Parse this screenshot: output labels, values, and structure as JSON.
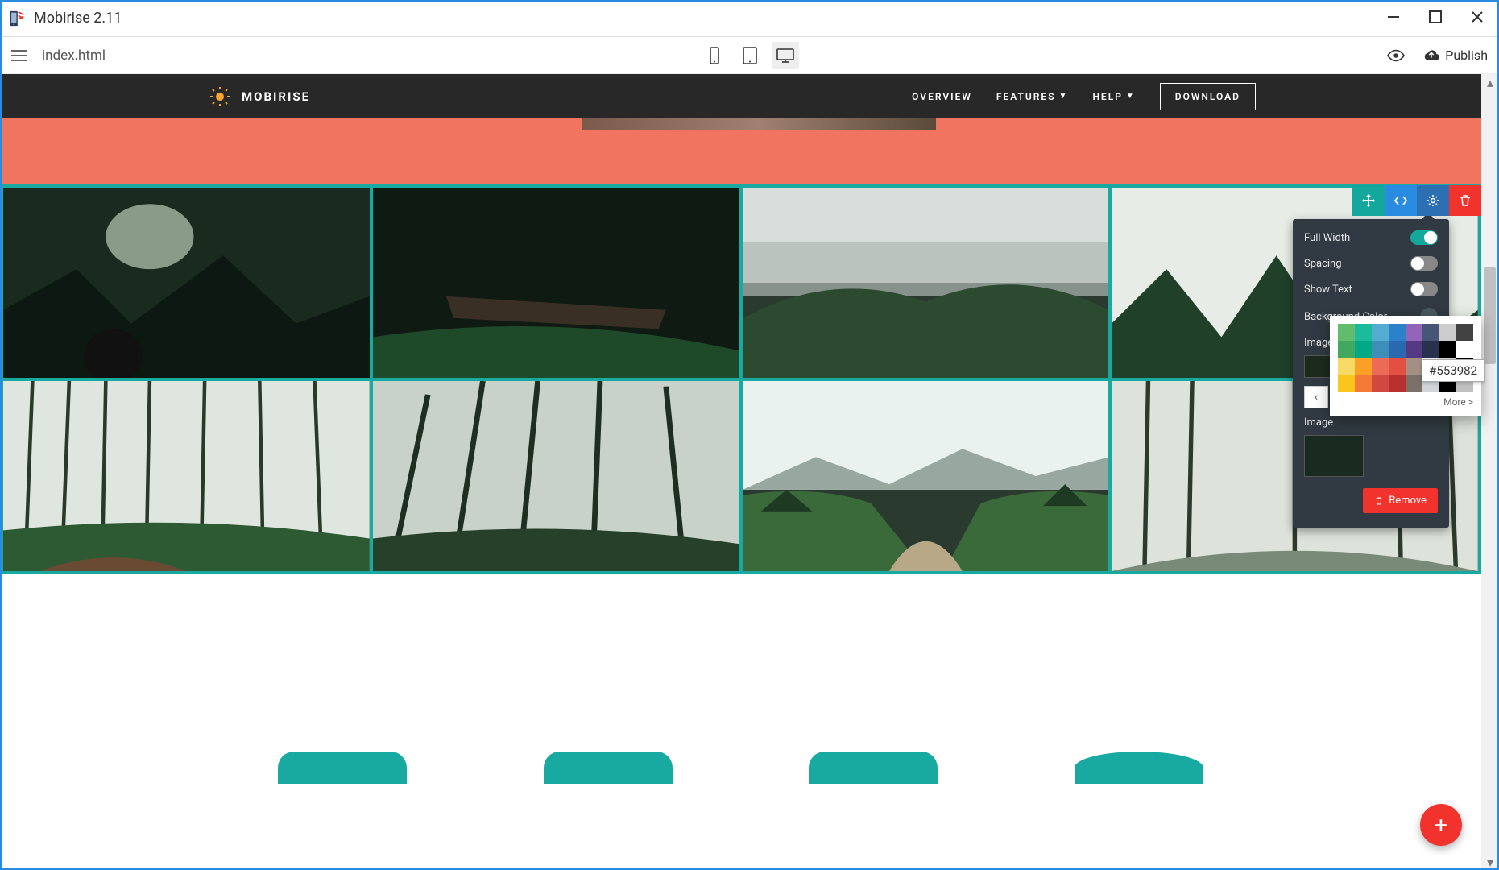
{
  "app": {
    "title": "Mobirise 2.11"
  },
  "toolbar": {
    "filename": "index.html",
    "publish_label": "Publish"
  },
  "site": {
    "brand": "MOBIRISE",
    "nav": {
      "overview": "OVERVIEW",
      "features": "FEATURES",
      "help": "HELP",
      "download": "DOWNLOAD"
    }
  },
  "block_toolbar": {
    "move": "move",
    "code": "code",
    "gear": "settings",
    "delete": "delete"
  },
  "settings": {
    "full_width": {
      "label": "Full Width",
      "on": true
    },
    "spacing": {
      "label": "Spacing",
      "on": false
    },
    "show_text": {
      "label": "Show Text",
      "on": false
    },
    "bg_color": {
      "label": "Background Color",
      "value": "#495862"
    },
    "images_label": "Images",
    "image_label": "Image",
    "remove_label": "Remove"
  },
  "color_picker": {
    "hover_hex": "#553982",
    "more_label": "More >",
    "swatches": [
      "#61BD6D",
      "#1ABC9C",
      "#54ACD2",
      "#2C82C9",
      "#9365B8",
      "#475577",
      "#CCCCCC",
      "#424242",
      "#41A85F",
      "#00A885",
      "#3D8EB9",
      "#2969B0",
      "#553982",
      "#28324E",
      "#000000",
      "#FFFFFF",
      "#F7DA64",
      "#FBA026",
      "#EB6B56",
      "#E25041",
      "#A38F84",
      "#EFEFEF",
      "#D1D5D8",
      "#000000",
      "#FAC51C",
      "#F37934",
      "#D14841",
      "#B8312F",
      "#7C706B",
      "#D1D5D8",
      "#000000",
      "#C0C0C0"
    ]
  },
  "fab": {
    "plus": "+"
  }
}
